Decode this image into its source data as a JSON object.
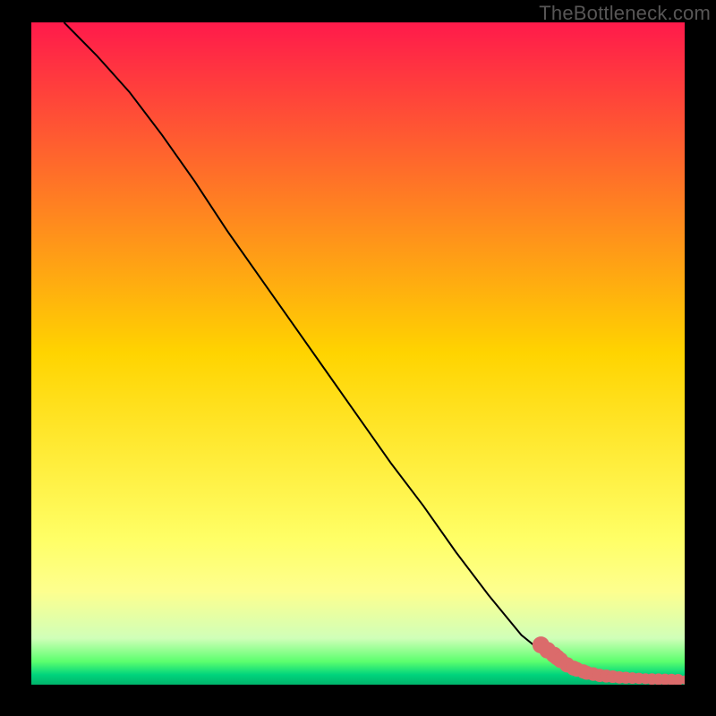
{
  "watermark": "TheBottleneck.com",
  "chart_data": {
    "type": "line",
    "title": "",
    "xlabel": "",
    "ylabel": "",
    "xlim": [
      0,
      100
    ],
    "ylim": [
      0,
      100
    ],
    "background_gradient": {
      "stops": [
        {
          "offset": 0.0,
          "color": "#ff1a4b"
        },
        {
          "offset": 0.5,
          "color": "#ffd400"
        },
        {
          "offset": 0.78,
          "color": "#ffff66"
        },
        {
          "offset": 0.86,
          "color": "#fdff8f"
        },
        {
          "offset": 0.93,
          "color": "#d0ffb8"
        },
        {
          "offset": 0.965,
          "color": "#5cff6e"
        },
        {
          "offset": 0.985,
          "color": "#00d47c"
        },
        {
          "offset": 1.0,
          "color": "#00b36b"
        }
      ]
    },
    "series": [
      {
        "name": "curve",
        "type": "line",
        "x": [
          5,
          10,
          15,
          20,
          25,
          27,
          30,
          35,
          40,
          45,
          50,
          55,
          60,
          65,
          70,
          75,
          80,
          82,
          85,
          88,
          90,
          92,
          94,
          96,
          98,
          100
        ],
        "y": [
          100,
          95,
          89.5,
          83,
          76,
          73,
          68.5,
          61.5,
          54.5,
          47.5,
          40.5,
          33.5,
          27,
          20,
          13.5,
          7.5,
          3.5,
          2.5,
          1.7,
          1.2,
          1.0,
          0.9,
          0.8,
          0.75,
          0.72,
          0.7
        ]
      },
      {
        "name": "data-points",
        "type": "scatter",
        "x": [
          78,
          79,
          80,
          80.5,
          81,
          82,
          83,
          83.5,
          84.5,
          85,
          86,
          87,
          88,
          89,
          90,
          91,
          92,
          93,
          94,
          95,
          96,
          97,
          98,
          99,
          100
        ],
        "y": [
          6.0,
          5.2,
          4.5,
          4.1,
          3.7,
          3.0,
          2.5,
          2.3,
          2.0,
          1.8,
          1.6,
          1.4,
          1.3,
          1.2,
          1.1,
          1.05,
          1.0,
          0.95,
          0.9,
          0.85,
          0.82,
          0.8,
          0.78,
          0.75,
          0.72
        ],
        "marker_color": "#db6b6b",
        "marker_radius_range": [
          4,
          9
        ]
      }
    ]
  }
}
